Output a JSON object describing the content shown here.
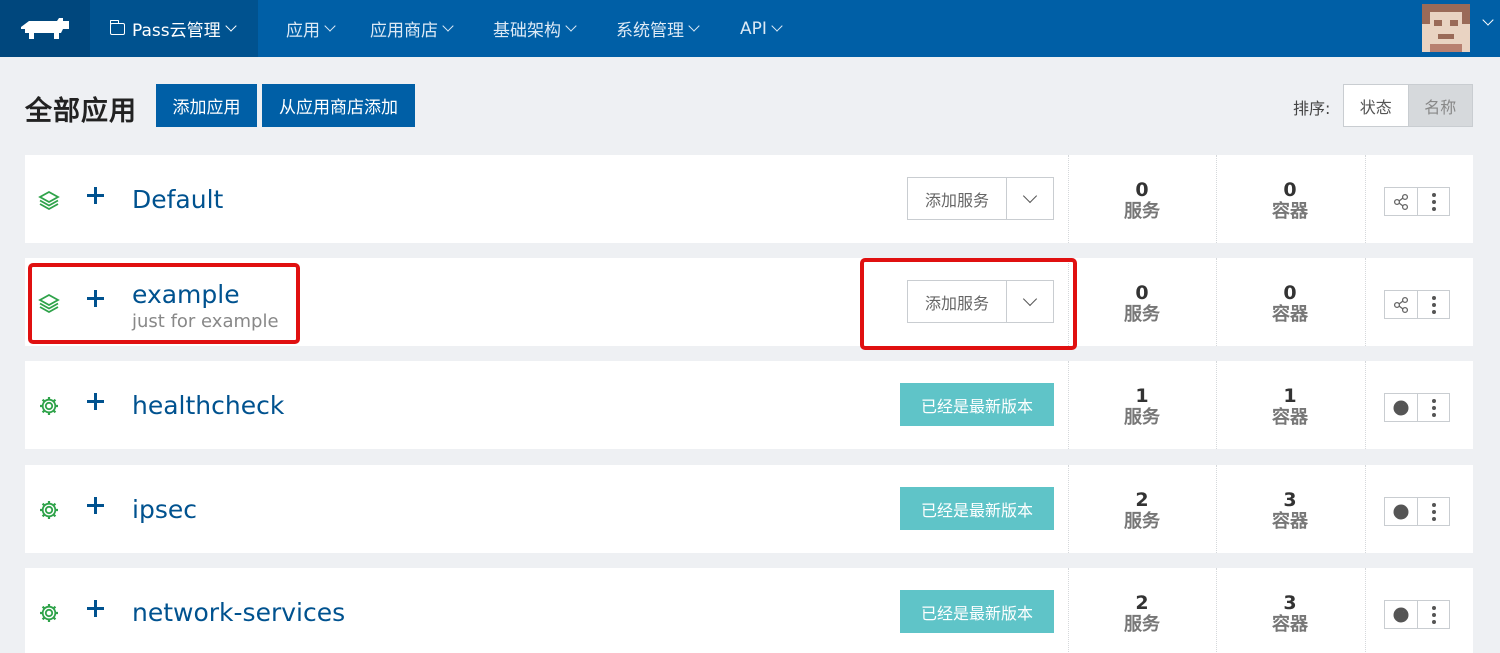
{
  "topbar": {
    "environment": "Pass云管理",
    "menu": [
      "应用",
      "应用商店",
      "基础架构",
      "系统管理",
      "API"
    ]
  },
  "header": {
    "title": "全部应用",
    "add_app": "添加应用",
    "add_from_catalog": "从应用商店添加",
    "sort_label": "排序:",
    "sort_options": [
      "状态",
      "名称"
    ],
    "sort_active": "名称"
  },
  "labels": {
    "add_service": "添加服务",
    "up_to_date": "已经是最新版本",
    "services": "服务",
    "containers": "容器"
  },
  "stacks": [
    {
      "name": "Default",
      "description": "",
      "icon": "layers-icon",
      "action": "add-service",
      "services": "0",
      "containers": "0"
    },
    {
      "name": "example",
      "description": "just for example",
      "icon": "layers-icon",
      "action": "add-service",
      "services": "0",
      "containers": "0"
    },
    {
      "name": "healthcheck",
      "description": "",
      "icon": "gear-icon",
      "action": "up-to-date",
      "services": "1",
      "containers": "1"
    },
    {
      "name": "ipsec",
      "description": "",
      "icon": "gear-icon",
      "action": "up-to-date",
      "services": "2",
      "containers": "3"
    },
    {
      "name": "network-services",
      "description": "",
      "icon": "gear-icon",
      "action": "up-to-date",
      "services": "2",
      "containers": "3"
    }
  ],
  "colors": {
    "nav": "#005fa6",
    "primary": "#005fa6",
    "badge": "#5fc4c8",
    "status_green": "#2fa34a",
    "highlight": "#e01010"
  }
}
